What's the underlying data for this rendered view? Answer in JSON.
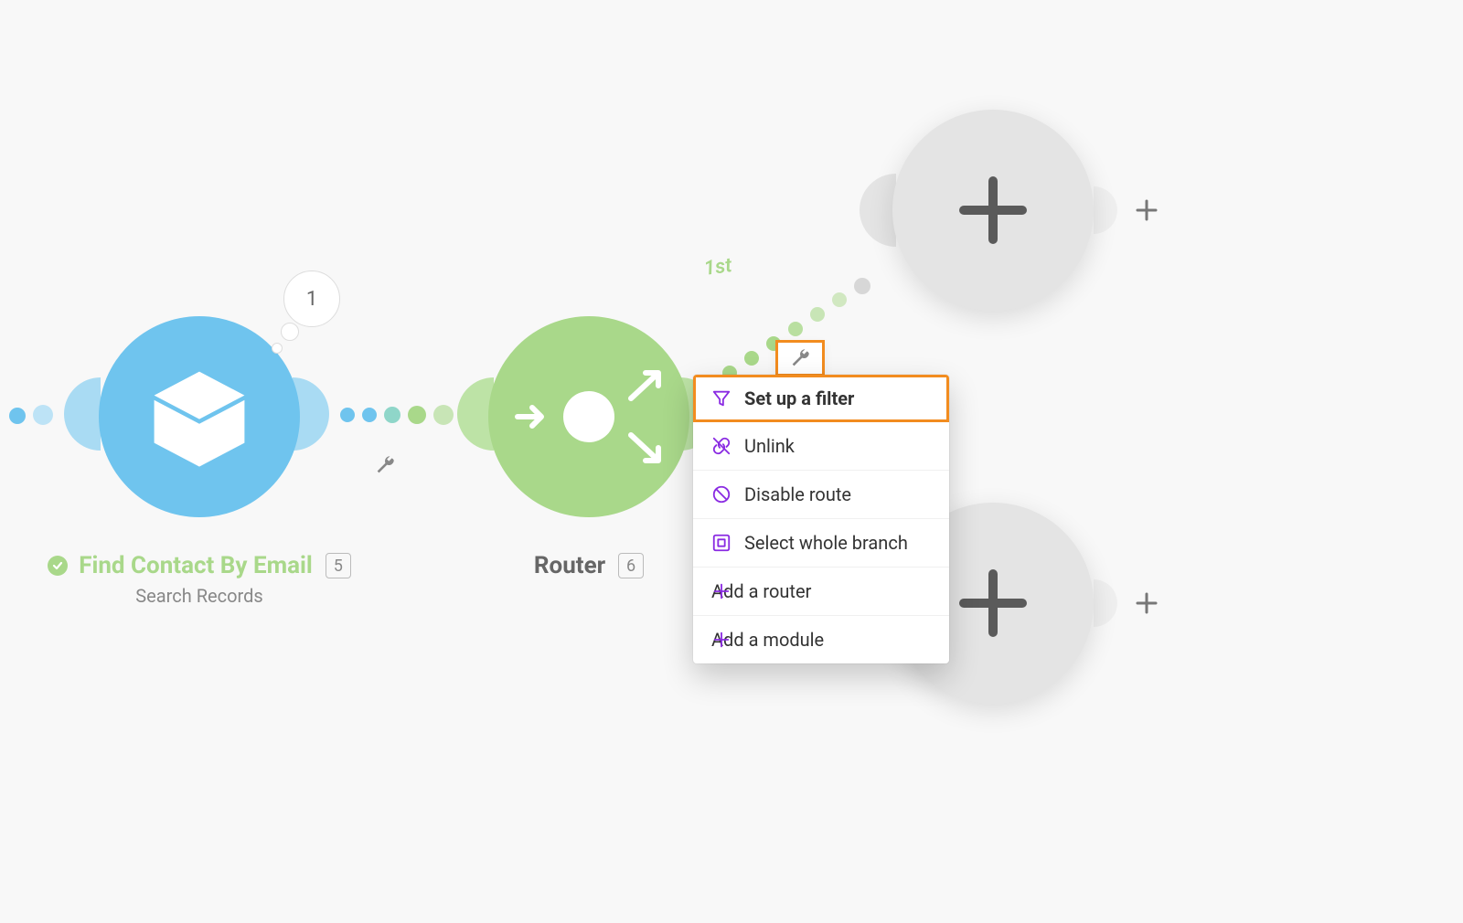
{
  "modules": {
    "contact": {
      "title": "Find Contact By Email",
      "subtitle": "Search Records",
      "index": "5",
      "bubble_count": "1"
    },
    "router": {
      "title": "Router",
      "index": "6",
      "branch_label": "1st"
    }
  },
  "context_menu": {
    "items": [
      {
        "icon": "filter",
        "label": "Set up a filter",
        "highlight": true
      },
      {
        "icon": "unlink",
        "label": "Unlink"
      },
      {
        "icon": "disable",
        "label": "Disable route"
      },
      {
        "icon": "select",
        "label": "Select whole branch"
      },
      {
        "icon": "plus",
        "label": "Add a router"
      },
      {
        "icon": "plus",
        "label": "Add a module"
      }
    ]
  }
}
